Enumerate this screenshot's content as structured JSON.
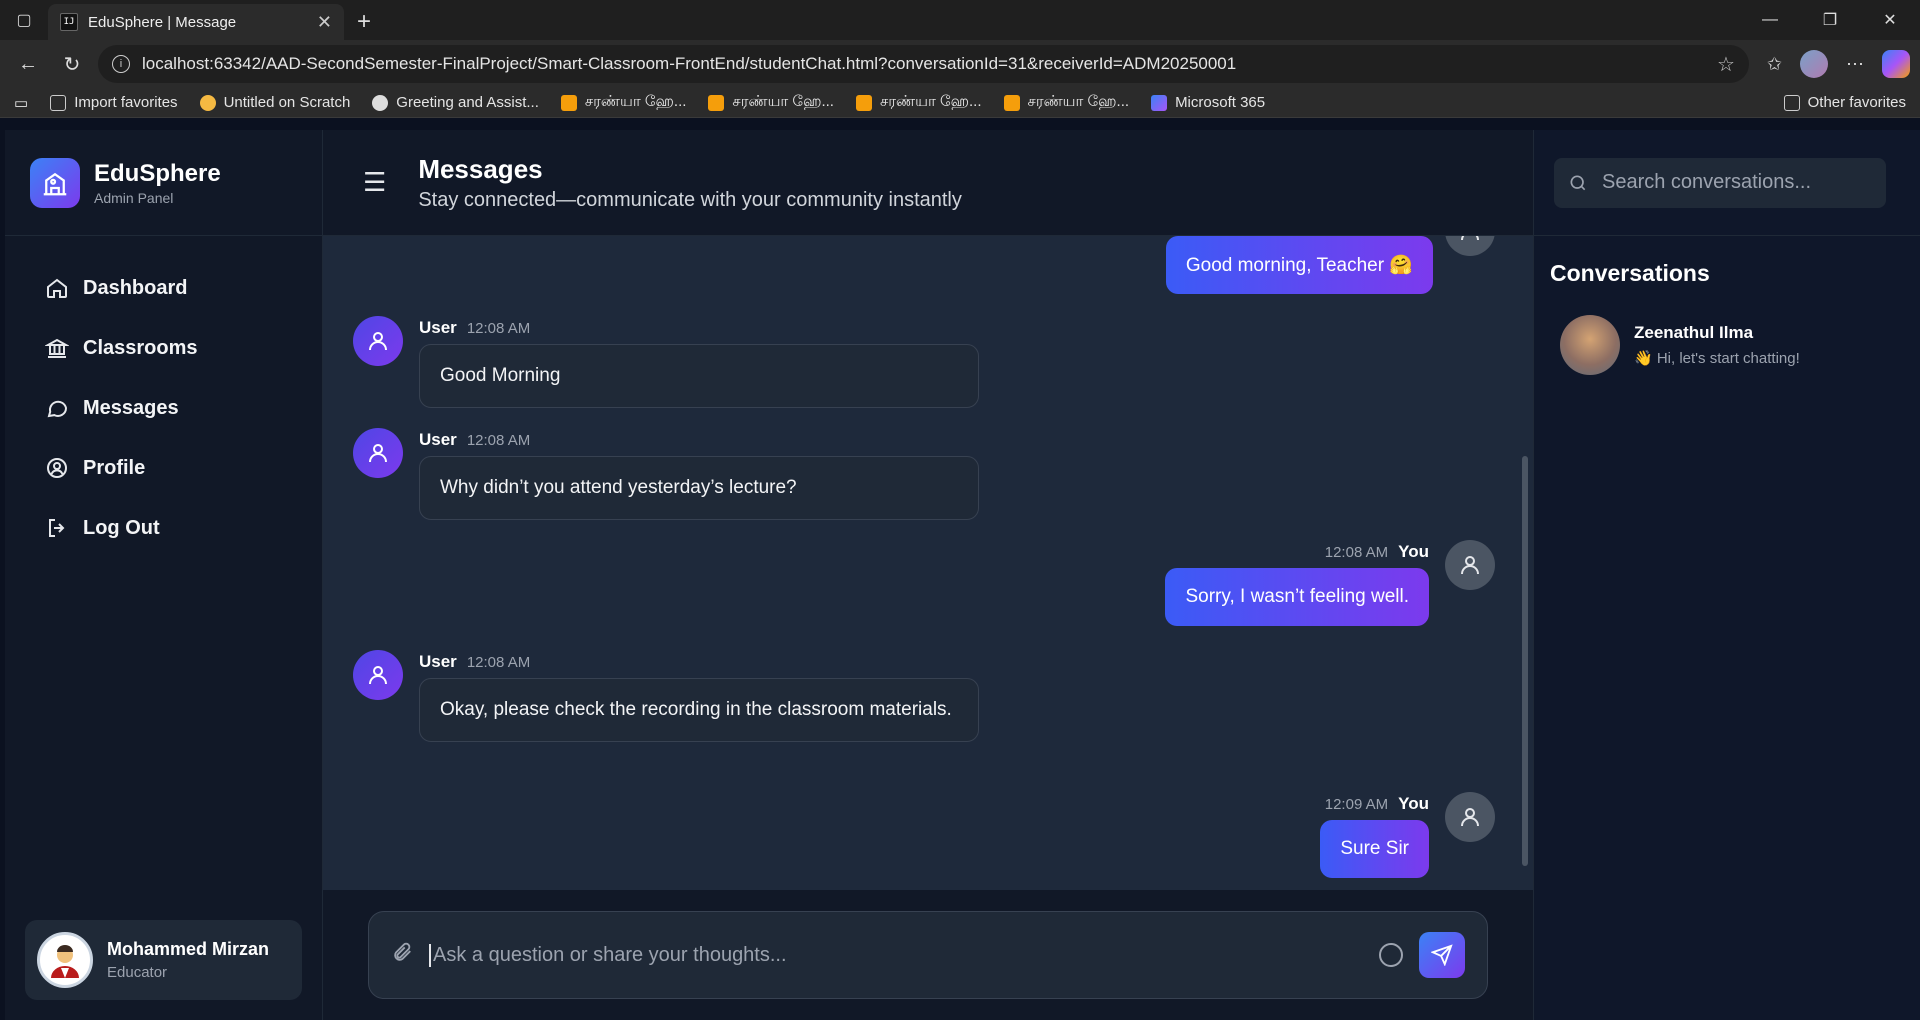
{
  "browser": {
    "tab_title": "EduSphere | Message",
    "url": "localhost:63342/AAD-SecondSemester-FinalProject/Smart-Classroom-FrontEnd/studentChat.html?conversationId=31&receiverId=ADM20250001",
    "bookmarks": [
      {
        "label": "Import favorites"
      },
      {
        "label": "Untitled on Scratch"
      },
      {
        "label": "Greeting and Assist..."
      },
      {
        "label": "சரண்யா ஹே..."
      },
      {
        "label": "சரண்யா ஹே..."
      },
      {
        "label": "சரண்யா ஹே..."
      },
      {
        "label": "சரண்யா ஹே..."
      },
      {
        "label": "Microsoft 365"
      }
    ],
    "other_favorites": "Other favorites"
  },
  "brand": {
    "name": "EduSphere",
    "subtitle": "Admin Panel"
  },
  "nav": [
    {
      "label": "Dashboard",
      "icon": "home-icon"
    },
    {
      "label": "Classrooms",
      "icon": "building-columns-icon"
    },
    {
      "label": "Messages",
      "icon": "chat-bubble-icon"
    },
    {
      "label": "Profile",
      "icon": "user-circle-icon"
    },
    {
      "label": "Log Out",
      "icon": "logout-icon"
    }
  ],
  "user": {
    "name": "Mohammed Mirzan",
    "role": "Educator"
  },
  "header": {
    "title": "Messages",
    "subtitle": "Stay connected—communicate with your community instantly"
  },
  "messages": [
    {
      "direction": "out",
      "sender": "",
      "time": "",
      "text": "Good morning, Teacher 🤗"
    },
    {
      "direction": "in",
      "sender": "User",
      "time": "12:08 AM",
      "text": "Good Morning"
    },
    {
      "direction": "in",
      "sender": "User",
      "time": "12:08 AM",
      "text": "Why didn’t you attend yesterday’s lecture?"
    },
    {
      "direction": "out",
      "sender": "You",
      "time": "12:08 AM",
      "text": "Sorry, I wasn’t feeling well."
    },
    {
      "direction": "in",
      "sender": "User",
      "time": "12:08 AM",
      "text": "Okay, please check the recording in the classroom materials."
    },
    {
      "direction": "out",
      "sender": "You",
      "time": "12:09 AM",
      "text": "Sure Sir"
    }
  ],
  "composer": {
    "placeholder": "Ask a question or share your thoughts..."
  },
  "search": {
    "placeholder": "Search conversations..."
  },
  "conversations": {
    "title": "Conversations",
    "items": [
      {
        "name": "Zeenathul Ilma",
        "preview": "👋 Hi, let's start chatting!"
      }
    ]
  },
  "colors": {
    "accent_start": "#3b5bf6",
    "accent_end": "#7c3aed",
    "sidebar_bg": "#111827",
    "chat_bg": "#1e293b"
  }
}
